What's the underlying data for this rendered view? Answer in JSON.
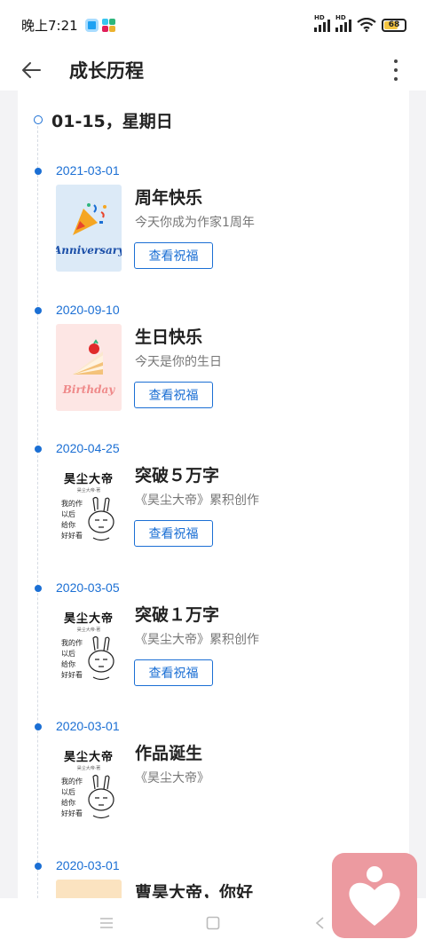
{
  "status_bar": {
    "time": "晚上7:21",
    "signal_1_label": "HD",
    "signal_2_label": "HD",
    "battery_level": "68",
    "battery_fraction": 0.68
  },
  "app_bar": {
    "title": "成长历程",
    "back_icon": "arrow-left-icon",
    "more_icon": "more-vertical-icon"
  },
  "timeline": {
    "header_date": "01-15，星期日",
    "accent_color": "#1b6fd4",
    "entries": [
      {
        "date": "2021-03-01",
        "title": "周年快乐",
        "desc": "今天你成为作家1周年",
        "button": "查看祝福",
        "thumb_label": "Anniversary",
        "thumb": "party-popper"
      },
      {
        "date": "2020-09-10",
        "title": "生日快乐",
        "desc": "今天是你的生日",
        "button": "查看祝福",
        "thumb_label": "Birthday",
        "thumb": "cake"
      },
      {
        "date": "2020-04-25",
        "title": "突破５万字",
        "desc": "《昊尘大帝》累积创作",
        "button": "查看祝福",
        "thumb": "book-cover"
      },
      {
        "date": "2020-03-05",
        "title": "突破１万字",
        "desc": "《昊尘大帝》累积创作",
        "button": "查看祝福",
        "thumb": "book-cover"
      },
      {
        "date": "2020-03-01",
        "title": "作品诞生",
        "desc": "《昊尘大帝》",
        "thumb": "book-cover"
      },
      {
        "date": "2020-03-01",
        "title": "曹昊大帝，你好",
        "thumb": "cake-partial"
      }
    ]
  },
  "book_cover": {
    "title": "昊尘大帝",
    "subtitle": "昊尘大帝·著",
    "caption_lines": [
      "我的作品",
      "以后",
      "给你",
      "好好看"
    ]
  },
  "nav_bar": {
    "menu_icon": "menu-icon",
    "home_icon": "square-home-icon",
    "back_icon": "triangle-back-icon"
  },
  "fab": {
    "icon": "heart-person-icon",
    "color": "#ec9aa0"
  }
}
